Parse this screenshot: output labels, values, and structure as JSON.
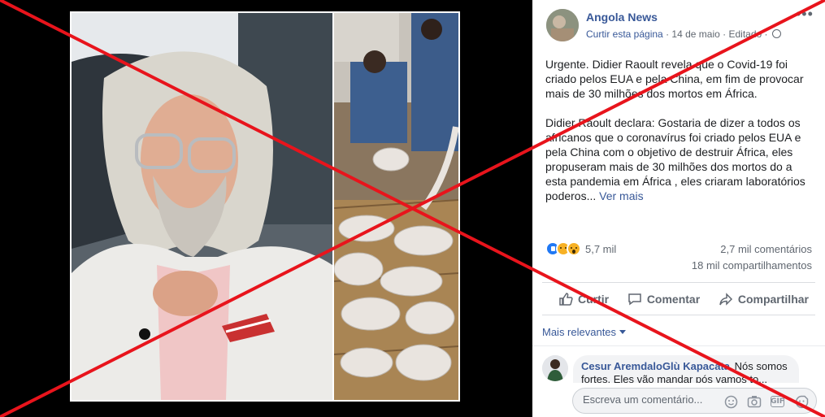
{
  "post": {
    "page_name": "Angola News",
    "follow_label": "Curtir esta página",
    "separator": "·",
    "date": "14 de maio",
    "edited_label": "Editado",
    "more_label": "•••",
    "text_paragraph_1": "Urgente. Didier Raoult revela que o Covid-19 foi criado pelos EUA e pela China, em fim de provocar mais de 30 milhões dos mortos em África.",
    "text_paragraph_2": "Didier Raoult declara: Gostaria de dizer a todos os africanos que o coronavírus foi criado pelos EUA e pela China com o objetivo de destruir África, eles propuseram mais de 30 milhões dos mortos do a esta pandemia em África , eles criaram laboratórios poderos...",
    "see_more_label": "Ver mais"
  },
  "reactions": {
    "icons": [
      "like-icon",
      "sad-icon",
      "wow-icon"
    ],
    "count": "5,7 mil",
    "comments": "2,7 mil comentários",
    "shares": "18 mil compartilhamentos"
  },
  "actions": {
    "like": "Curtir",
    "comment": "Comentar",
    "share": "Compartilhar"
  },
  "comments": {
    "sort_label": "Mais relevantes",
    "first_author": "Cesur AremdaloGlù Kapacata",
    "first_text": "Nós somos fortes. Eles vão mandar pós vamos to...",
    "input_placeholder": "Escreva um comentário...",
    "input_icons": [
      "emoji-icon",
      "camera-icon",
      "gif-icon",
      "sticker-icon"
    ],
    "gif_label": "GIF"
  },
  "colors": {
    "link_blue": "#385898",
    "cross_red": "#e8141c",
    "like_blue": "#2078f4",
    "reaction_yellow": "#f7b125"
  }
}
